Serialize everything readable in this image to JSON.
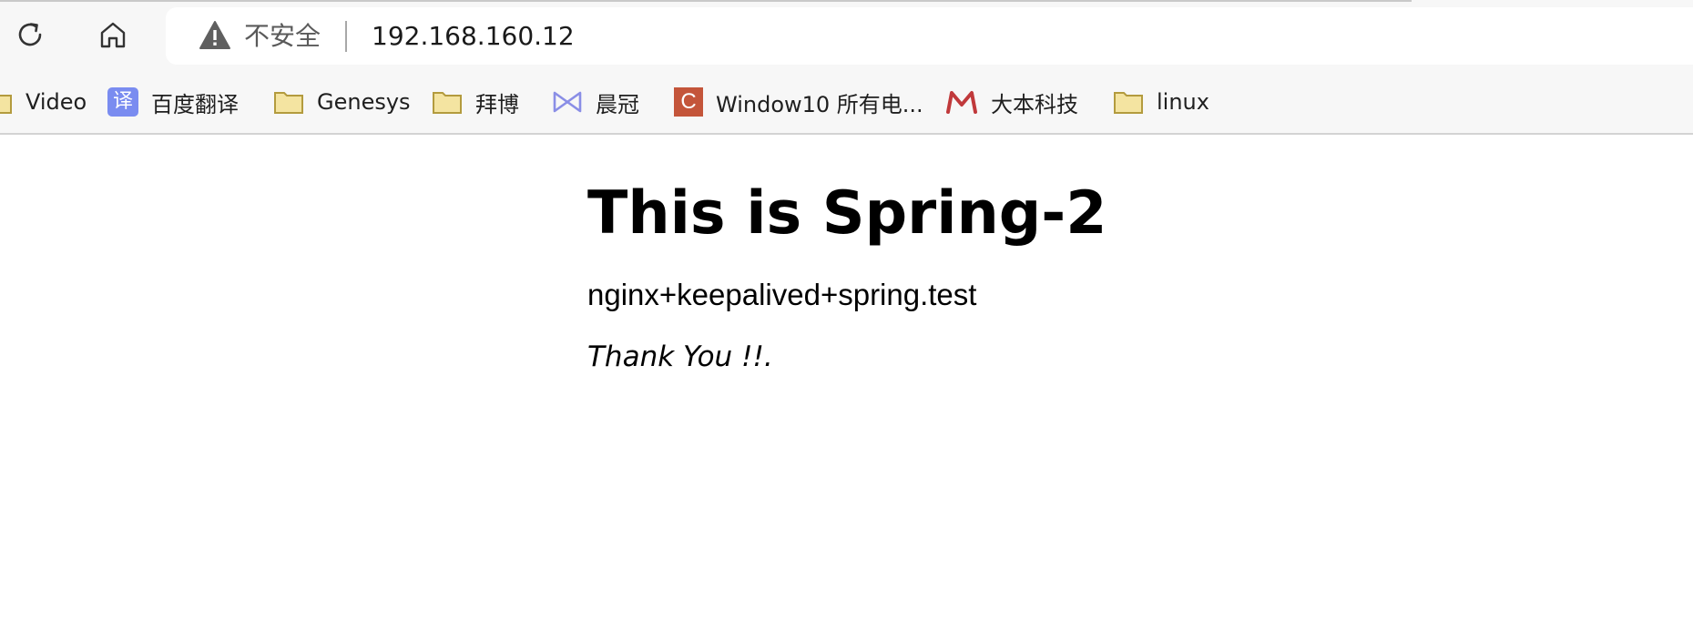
{
  "browser": {
    "security_label": "不安全",
    "url": "192.168.160.12",
    "icons": {
      "reload": "reload-icon",
      "home": "home-icon",
      "warning": "warning-icon"
    }
  },
  "bookmarks": [
    {
      "label": "Video",
      "icon": "folder-icon"
    },
    {
      "label": "百度翻译",
      "icon": "baidu-translate-icon",
      "icon_text": "译",
      "icon_color": "#7a8cf0"
    },
    {
      "label": "Genesys",
      "icon": "folder-icon"
    },
    {
      "label": "拜博",
      "icon": "folder-icon"
    },
    {
      "label": "晨冠",
      "icon": "chenguan-logo-icon",
      "icon_color": "#8a8ee6"
    },
    {
      "label": "Window10 所有电...",
      "icon": "c-logo-icon",
      "icon_text": "C",
      "icon_color": "#c4553a"
    },
    {
      "label": "大本科技",
      "icon": "m-logo-icon",
      "icon_color": "#c0393b"
    },
    {
      "label": "linux",
      "icon": "folder-icon"
    }
  ],
  "page": {
    "heading": "This is Spring-2",
    "subtitle": "nginx+keepalived+spring.test",
    "thanks": "Thank You !!."
  },
  "colors": {
    "folder_fill": "#f4e4a1",
    "folder_stroke": "#b39b3e",
    "toolbar_bg": "#f7f7f7"
  }
}
